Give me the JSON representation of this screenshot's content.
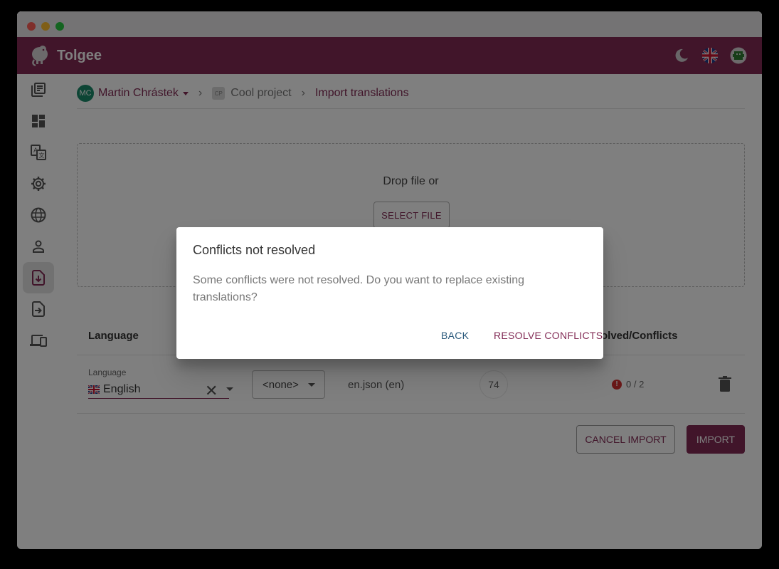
{
  "app": {
    "brand": "Tolgee",
    "brand_color": "#822b55"
  },
  "appbar": {
    "icons": [
      "moon-icon",
      "uk-flag-icon",
      "user-avatar-icon"
    ]
  },
  "sidebar": {
    "items": [
      {
        "icon": "projects-list-icon",
        "active": false
      },
      {
        "icon": "dashboard-icon",
        "active": false
      },
      {
        "icon": "translations-icon",
        "active": false
      },
      {
        "icon": "settings-gear-icon",
        "active": false
      },
      {
        "icon": "languages-globe-icon",
        "active": false
      },
      {
        "icon": "members-person-icon",
        "active": false
      },
      {
        "icon": "import-icon",
        "active": true
      },
      {
        "icon": "export-icon",
        "active": false
      },
      {
        "icon": "integrate-devices-icon",
        "active": false
      }
    ]
  },
  "breadcrumb": {
    "user_initials": "MC",
    "user_name": "Martin Chrástek",
    "project_initials": "CP",
    "project_name": "Cool project",
    "page": "Import translations"
  },
  "dropzone": {
    "text": "Drop file or",
    "button": "SELECT FILE"
  },
  "table": {
    "headers": {
      "language": "Language",
      "resolved": "olved/Conflicts"
    },
    "row": {
      "language_label": "Language",
      "language_value": "English",
      "namespace_value": "<none>",
      "file_name": "en.json (en)",
      "count": "74",
      "conflicts": "0 / 2"
    }
  },
  "actions": {
    "cancel": "CANCEL IMPORT",
    "import": "IMPORT"
  },
  "dialog": {
    "title": "Conflicts not resolved",
    "text": "Some conflicts were not resolved. Do you want to replace existing translations?",
    "back": "BACK",
    "resolve": "RESOLVE CONFLICTS"
  }
}
